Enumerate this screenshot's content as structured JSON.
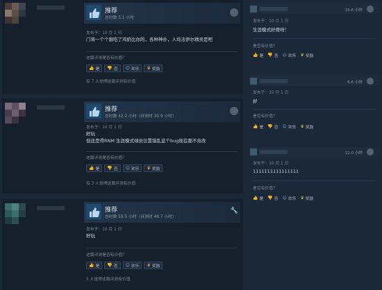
{
  "reviews": [
    {
      "recommendation": "推荐",
      "hours": "总时数 5.1 小时",
      "posted": "发布于：10 月 1 日",
      "body_lines": [
        "门将一个个跟吃了鸡奶比你的，各种神扑，人均法伊尔精灵是吧"
      ],
      "question": "这篇评测是否有价值？",
      "buttons": [
        "是",
        "否",
        "欢乐",
        "奖励"
      ],
      "found": "有 7 人觉得这篇评测有价值"
    },
    {
      "recommendation": "推荐",
      "hours": "总时数 42.2 小时（评测时 30.9 小时）",
      "posted": "发布于：10 月 1 日",
      "body_lines": [
        "好玩",
        "但还是得RNM 生涯模式球员位置错乱这个bug现在都不肯改"
      ],
      "question": "这篇评测是否有价值？",
      "buttons": [
        "是",
        "否",
        "欢乐",
        "奖励"
      ],
      "found": "有 3 人觉得这篇评测有价值"
    },
    {
      "recommendation": "推荐",
      "hours": "总时数 59.5 小时（评测时 48.7 小时）",
      "posted": "发布于：10 月 1 日",
      "body_lines": [
        "好玩"
      ],
      "question": "这篇评测是否有价值？",
      "buttons": [
        "是",
        "否",
        "欢乐",
        "奖励"
      ],
      "found": "1 人觉得这篇评测有价值"
    }
  ],
  "comments": [
    {
      "time": "15.6 小时",
      "posted": "发布于：10 月 1 日",
      "text": "生涯模式好傻呀！",
      "question": "是否有价值？",
      "buttons": [
        "是",
        "否",
        "欢乐",
        "奖励"
      ]
    },
    {
      "time": "6.6 小时",
      "posted": "发布于：10 月 1 日",
      "text": "好",
      "question": "是否有价值？",
      "buttons": [
        "是",
        "否",
        "欢乐",
        "奖励"
      ]
    },
    {
      "time": "12.0 小时",
      "posted": "发布于：10 月 1 日",
      "text": "1111111111111111",
      "question": "是否有价值？",
      "buttons": [
        "是",
        "否",
        "欢乐",
        "奖励"
      ]
    }
  ],
  "colors": {
    "background": "#1b2838",
    "card": "#16202d",
    "header_band": "#23354a",
    "thumb": "#1f4a6e",
    "text": "#c6d4df",
    "muted": "#7b8794",
    "award": "#e8c14a",
    "vote_icon": "#6aa7d6"
  },
  "icons": {
    "thumb": "thumbs-up-icon",
    "steam": "steam-logo-icon",
    "wrench": "wrench-icon",
    "yes": "thumbs-up-icon",
    "no": "thumbs-down-icon",
    "funny": "smiley-icon",
    "award": "award-icon"
  }
}
